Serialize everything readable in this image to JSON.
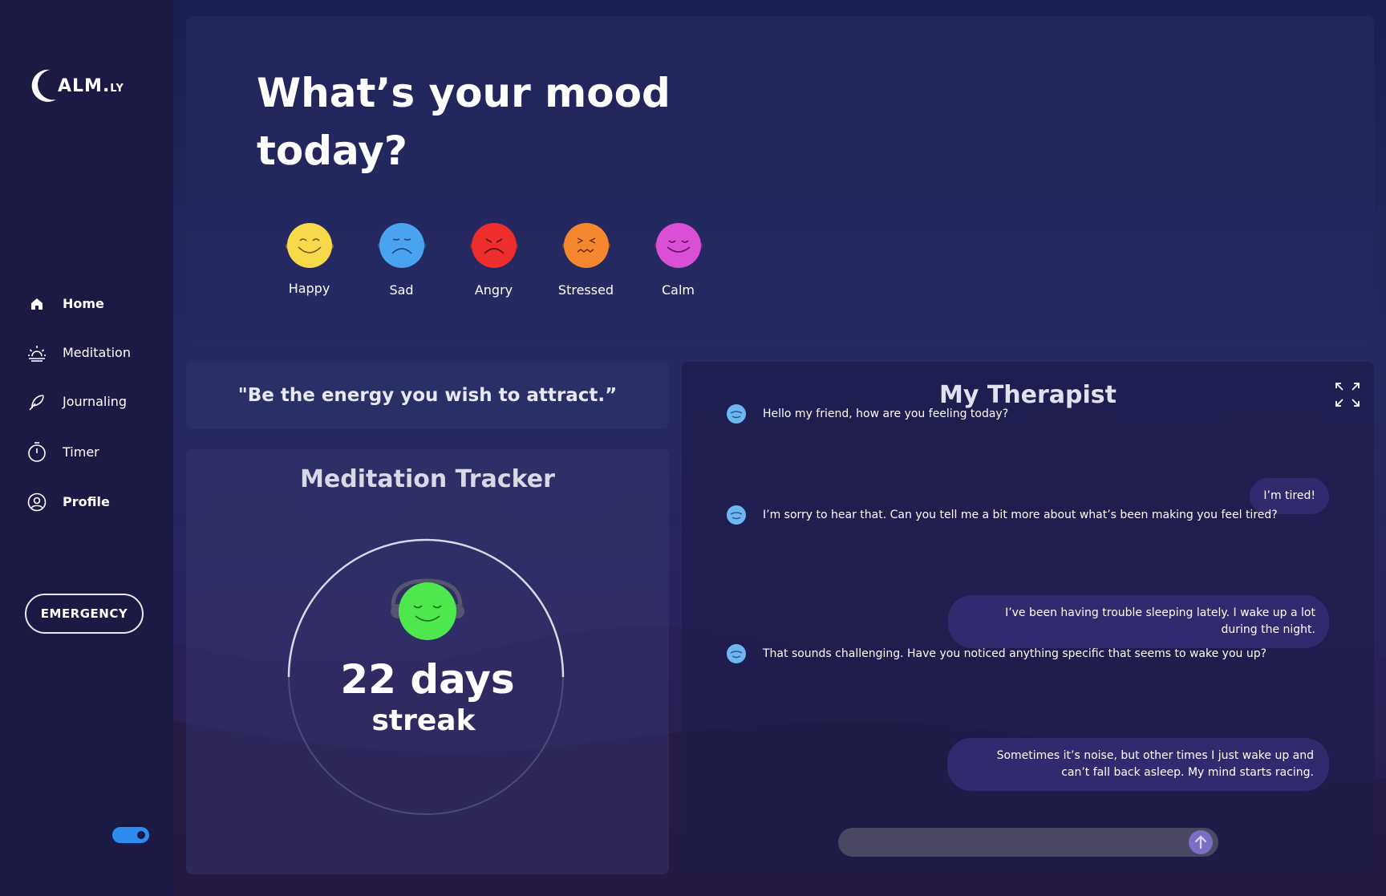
{
  "app": {
    "logo_main": "ALM.",
    "logo_suffix": "LY"
  },
  "sidebar": {
    "items": [
      {
        "label": "Home",
        "icon": "home-icon"
      },
      {
        "label": "Meditation",
        "icon": "sunrise-icon"
      },
      {
        "label": "Journaling",
        "icon": "feather-icon"
      },
      {
        "label": "Timer",
        "icon": "timer-icon"
      },
      {
        "label": "Profile",
        "icon": "user-circle-icon"
      }
    ],
    "emergency_label": "EMERGENCY"
  },
  "mood": {
    "title": "What’s your mood today?",
    "options": [
      {
        "label": "Happy",
        "color": "#f8d94a"
      },
      {
        "label": "Sad",
        "color": "#4aa3f0"
      },
      {
        "label": "Angry",
        "color": "#ee2d2d"
      },
      {
        "label": "Stressed",
        "color": "#f5882e"
      },
      {
        "label": "Calm",
        "color": "#d94fd6"
      }
    ]
  },
  "quote": {
    "text": "\"Be the energy you wish to attract.”"
  },
  "tracker": {
    "title": "Meditation Tracker",
    "streak_value": "22 days",
    "streak_label": "streak",
    "face_color": "#4ee84e"
  },
  "chat": {
    "title": "My Therapist",
    "messages": [
      {
        "from": "therapist",
        "text": "Hello my friend, how are you feeling today?"
      },
      {
        "from": "user",
        "text": "I’m tired!"
      },
      {
        "from": "therapist",
        "text": "I’m sorry to hear that. Can you tell me a bit more about what’s been making you feel tired?"
      },
      {
        "from": "user",
        "text": "I’ve been having trouble sleeping lately. I wake up a lot during the night."
      },
      {
        "from": "therapist",
        "text": "That sounds challenging. Have you noticed anything specific that seems to wake you up?"
      },
      {
        "from": "user",
        "text": "Sometimes it’s noise, but other times I just wake up and can’t fall back asleep. My mind starts racing."
      }
    ],
    "input_placeholder": ""
  },
  "colors": {
    "accent": "#2d8cf0",
    "sidebar_bg": "#1a1a44"
  }
}
